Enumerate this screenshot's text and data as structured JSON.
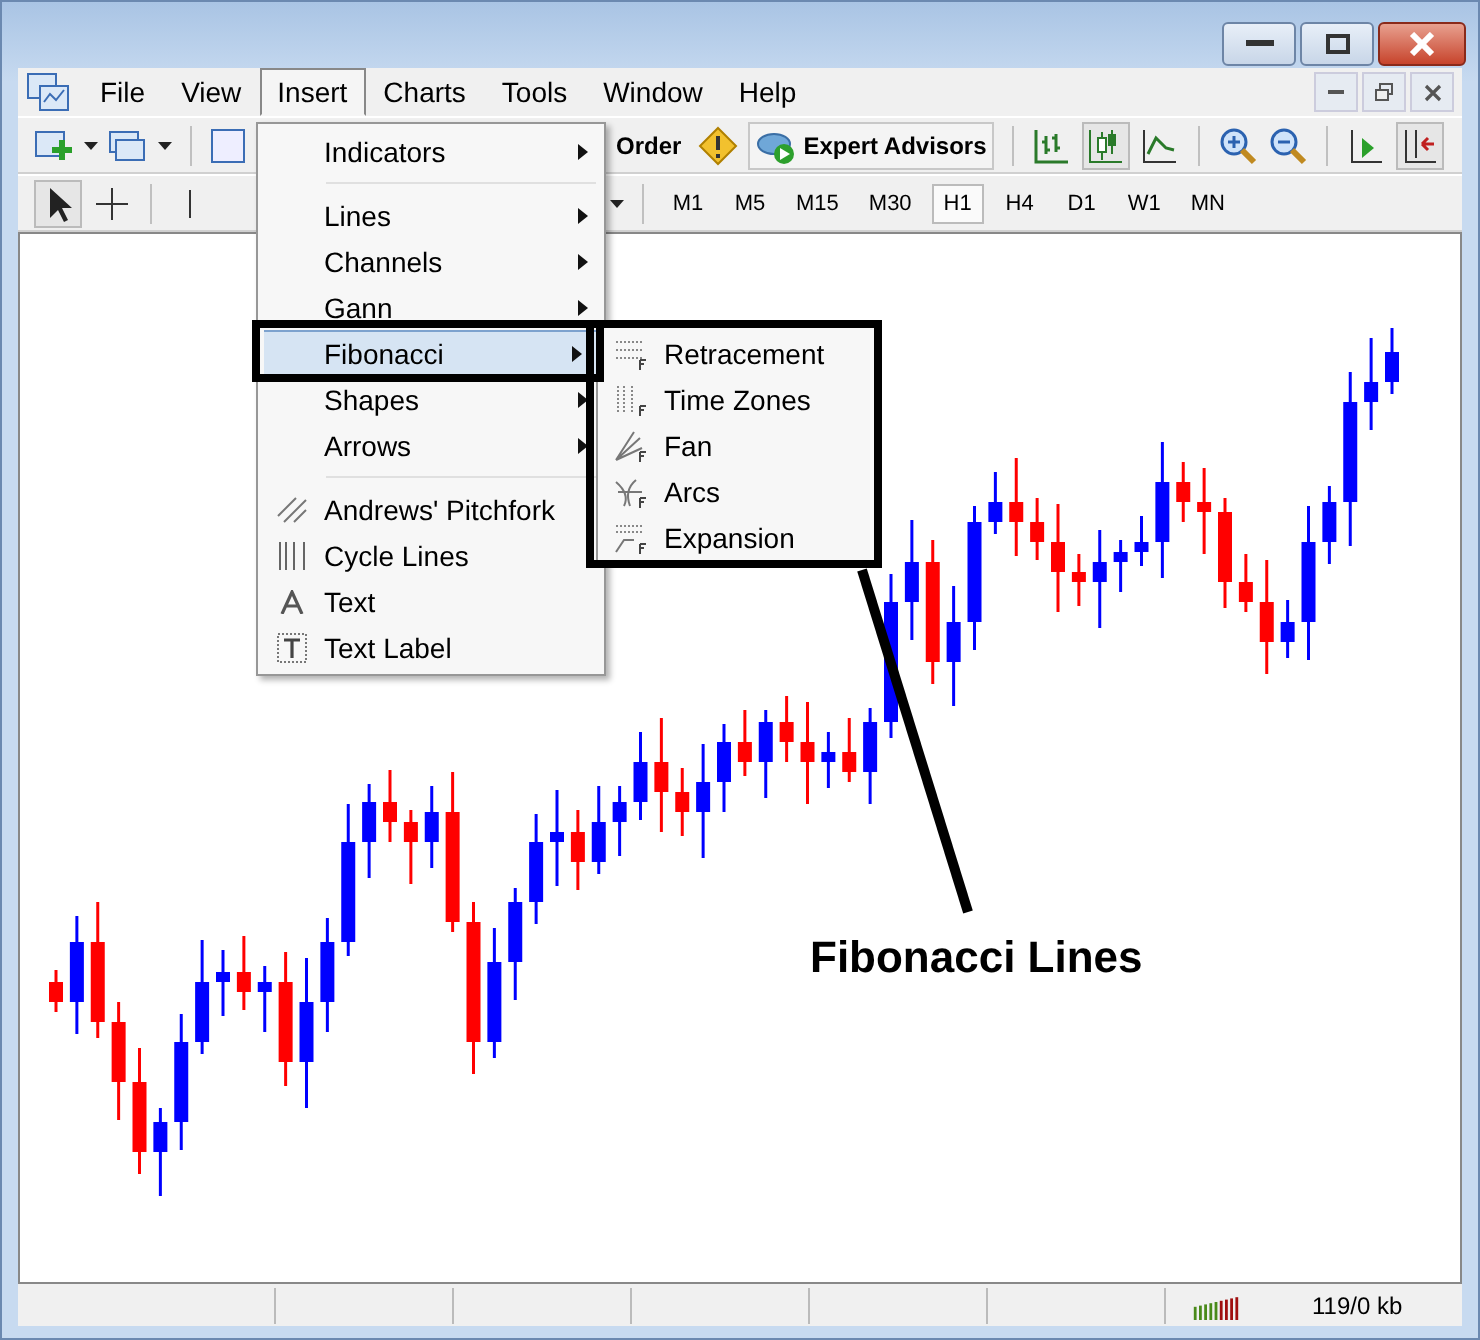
{
  "menu_bar": {
    "items": [
      {
        "label": "File",
        "selected": false
      },
      {
        "label": "View",
        "selected": false
      },
      {
        "label": "Insert",
        "selected": true
      },
      {
        "label": "Charts",
        "selected": false
      },
      {
        "label": "Tools",
        "selected": false
      },
      {
        "label": "Window",
        "selected": false
      },
      {
        "label": "Help",
        "selected": false
      }
    ]
  },
  "toolbar": {
    "order_button": "Order",
    "experts_button": "Expert Advisors"
  },
  "timeframes": [
    {
      "label": "M1",
      "selected": false
    },
    {
      "label": "M5",
      "selected": false
    },
    {
      "label": "M15",
      "selected": false
    },
    {
      "label": "M30",
      "selected": false
    },
    {
      "label": "H1",
      "selected": true
    },
    {
      "label": "H4",
      "selected": false
    },
    {
      "label": "D1",
      "selected": false
    },
    {
      "label": "W1",
      "selected": false
    },
    {
      "label": "MN",
      "selected": false
    }
  ],
  "insert_menu": {
    "groups": [
      [
        {
          "label": "Indicators",
          "submenu": true,
          "selected": false
        }
      ],
      [
        {
          "label": "Lines",
          "submenu": true,
          "selected": false
        },
        {
          "label": "Channels",
          "submenu": true,
          "selected": false
        },
        {
          "label": "Gann",
          "submenu": true,
          "selected": false
        },
        {
          "label": "Fibonacci",
          "submenu": true,
          "selected": true
        },
        {
          "label": "Shapes",
          "submenu": true,
          "selected": false
        },
        {
          "label": "Arrows",
          "submenu": true,
          "selected": false
        }
      ],
      [
        {
          "label": "Andrews' Pitchfork",
          "submenu": false,
          "selected": false
        },
        {
          "label": "Cycle Lines",
          "submenu": false,
          "selected": false
        },
        {
          "label": "Text",
          "submenu": false,
          "selected": false
        },
        {
          "label": "Text Label",
          "submenu": false,
          "selected": false
        }
      ]
    ]
  },
  "fibonacci_submenu": {
    "items": [
      {
        "label": "Retracement"
      },
      {
        "label": "Time Zones"
      },
      {
        "label": "Fan"
      },
      {
        "label": "Arcs"
      },
      {
        "label": "Expansion"
      }
    ]
  },
  "annotation": {
    "label": "Fibonacci Lines"
  },
  "status_bar": {
    "traffic": "119/0 kb"
  }
}
